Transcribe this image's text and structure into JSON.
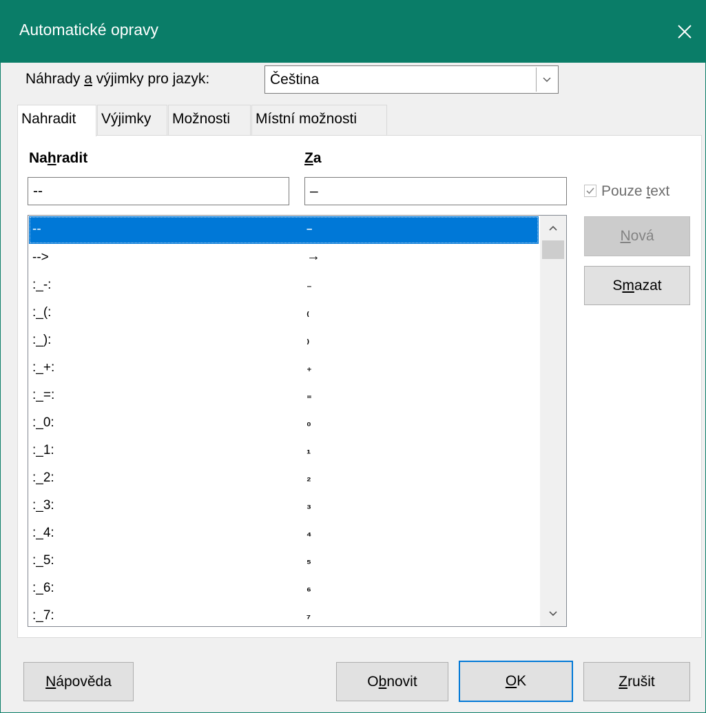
{
  "window": {
    "title": "Automatické opravy"
  },
  "language": {
    "label_pre": "Náhrady ",
    "label_key": "a",
    "label_post": " výjimky pro jazyk:",
    "selected": "Čeština"
  },
  "tabs": [
    {
      "label": "Nahradit",
      "active": true
    },
    {
      "label": "Výjimky",
      "active": false
    },
    {
      "label": "Možnosti",
      "active": false
    },
    {
      "label": "Místní možnosti",
      "active": false
    }
  ],
  "replace": {
    "col1_header_pre": "Na",
    "col1_header_key": "h",
    "col1_header_post": "radit",
    "col2_header_key": "Z",
    "col2_header_post": "a",
    "replace_value": "--",
    "with_value": "–",
    "text_only": {
      "checked": true,
      "label_pre": "Pouze ",
      "label_key": "t",
      "label_post": "ext"
    },
    "rows": [
      {
        "from": "--",
        "to": "–"
      },
      {
        "from": "-->",
        "to": "→"
      },
      {
        "from": ":_-:",
        "to": "₋"
      },
      {
        "from": ":_(:",
        "to": "₍"
      },
      {
        "from": ":_):",
        "to": "₎"
      },
      {
        "from": ":_+:",
        "to": "₊"
      },
      {
        "from": ":_=:",
        "to": "₌"
      },
      {
        "from": ":_0:",
        "to": "₀"
      },
      {
        "from": ":_1:",
        "to": "₁"
      },
      {
        "from": ":_2:",
        "to": "₂"
      },
      {
        "from": ":_3:",
        "to": "₃"
      },
      {
        "from": ":_4:",
        "to": "₄"
      },
      {
        "from": ":_5:",
        "to": "₅"
      },
      {
        "from": ":_6:",
        "to": "₆"
      },
      {
        "from": ":_7:",
        "to": "₇"
      }
    ]
  },
  "side_buttons": {
    "new_pre": "",
    "new_key": "N",
    "new_post": "ová",
    "delete_pre": "S",
    "delete_key": "m",
    "delete_post": "azat"
  },
  "footer": {
    "help_pre": "",
    "help_key": "N",
    "help_post": "ápověda",
    "reset_pre": "O",
    "reset_key": "b",
    "reset_post": "novit",
    "ok_pre": "",
    "ok_key": "O",
    "ok_post": "K",
    "cancel_pre": "",
    "cancel_key": "Z",
    "cancel_post": "rušit"
  }
}
